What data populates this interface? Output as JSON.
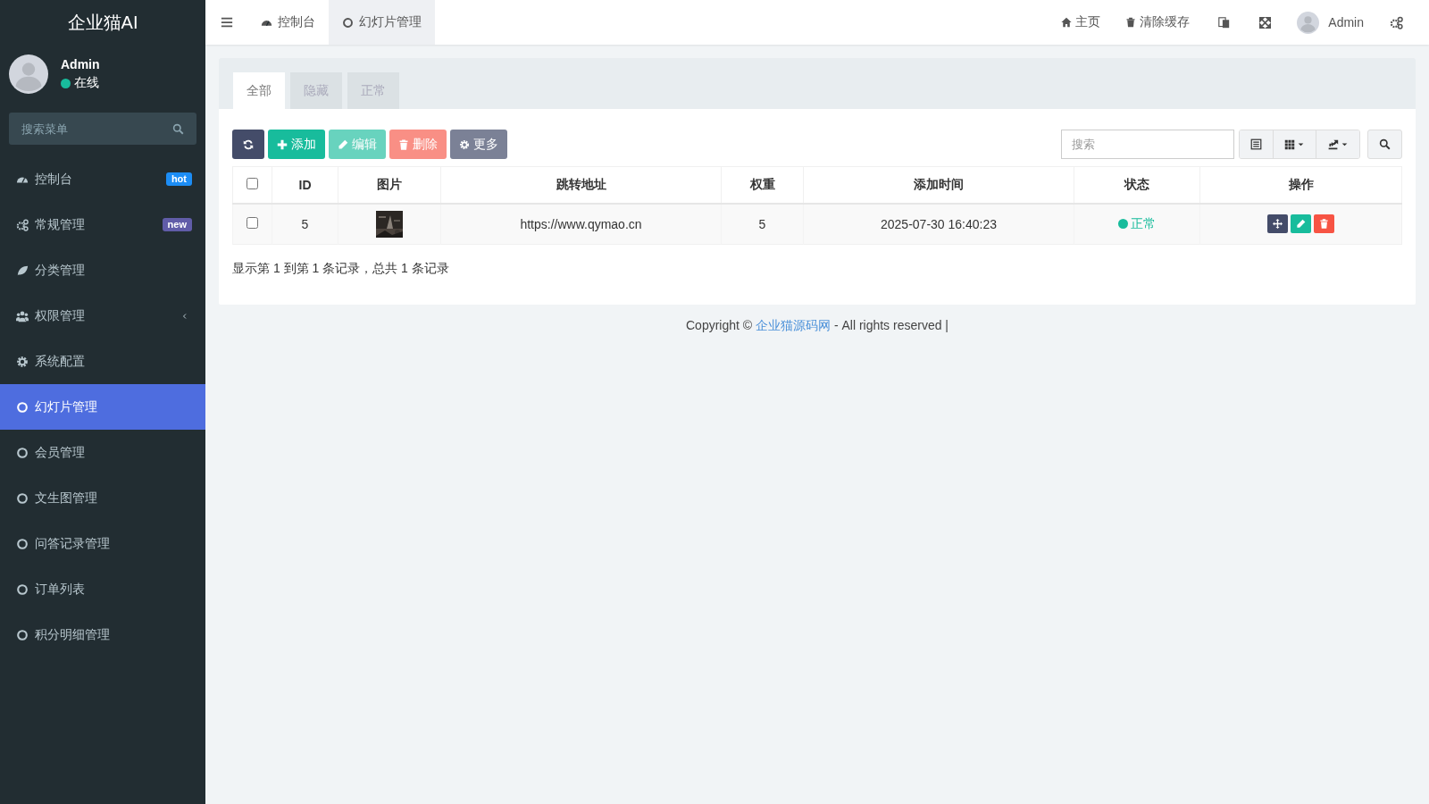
{
  "sidebar": {
    "logo": "企业猫AI",
    "user": {
      "name": "Admin",
      "status": "在线",
      "online": true
    },
    "search": {
      "placeholder": "搜索菜单"
    },
    "items": [
      {
        "label": "控制台",
        "selected": false,
        "badge": {
          "text": "hot",
          "color": "#1c8df5"
        }
      },
      {
        "label": "常规管理",
        "selected": false,
        "badge": {
          "text": "new",
          "color": "#605ca8"
        }
      },
      {
        "label": "分类管理",
        "selected": false
      },
      {
        "label": "权限管理",
        "selected": false,
        "expanded": false
      },
      {
        "label": "系统配置",
        "selected": false
      },
      {
        "label": "幻灯片管理",
        "selected": true
      },
      {
        "label": "会员管理",
        "selected": false
      },
      {
        "label": "文生图管理",
        "selected": false
      },
      {
        "label": "问答记录管理",
        "selected": false
      },
      {
        "label": "订单列表",
        "selected": false
      },
      {
        "label": "积分明细管理",
        "selected": false
      }
    ]
  },
  "header": {
    "tabs": [
      {
        "label": "控制台",
        "selected": false
      },
      {
        "label": "幻灯片管理",
        "selected": true
      }
    ],
    "links": [
      {
        "label": "主页"
      },
      {
        "label": "清除缓存"
      }
    ],
    "user": "Admin"
  },
  "panel": {
    "tabs": [
      {
        "label": "全部",
        "selected": true
      },
      {
        "label": "隐藏",
        "selected": false
      },
      {
        "label": "正常",
        "selected": false
      }
    ],
    "toolbar": [
      {
        "kind": "refresh",
        "disabled": false
      },
      {
        "kind": "add",
        "label": "添加",
        "disabled": false
      },
      {
        "kind": "edit",
        "label": "编辑",
        "disabled": true
      },
      {
        "kind": "delete",
        "label": "删除",
        "disabled": true
      },
      {
        "kind": "more",
        "label": "更多",
        "disabled": false
      }
    ],
    "search": {
      "placeholder": "搜索"
    },
    "table": {
      "select_all_checked": false,
      "columns": [
        "ID",
        "图片",
        "跳转地址",
        "权重",
        "添加时间",
        "状态",
        "操作"
      ],
      "rows": [
        {
          "checked": false,
          "id": "5",
          "url": "https://www.qymao.cn",
          "weight": "5",
          "time": "2025-07-30 16:40:23",
          "status": {
            "text": "正常",
            "color": "#18bc9c"
          }
        }
      ]
    },
    "summary": "显示第 1 到第 1 条记录，总共 1 条记录"
  },
  "footer": {
    "before": "Copyright © ",
    "link": "企业猫源码网",
    "after": " - All rights reserved |"
  }
}
